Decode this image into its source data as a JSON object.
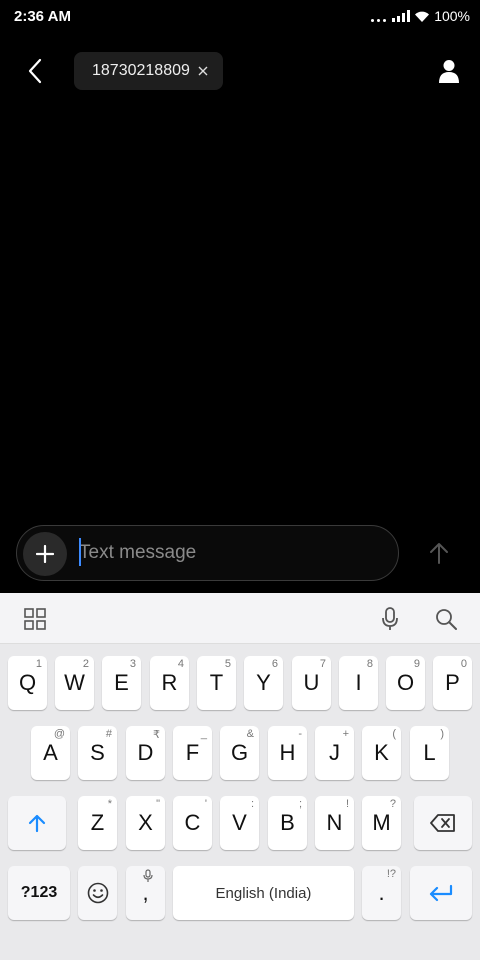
{
  "status": {
    "time": "2:36 AM",
    "battery": "100%"
  },
  "header": {
    "recipient": "18730218809"
  },
  "compose": {
    "placeholder": "Text message"
  },
  "keyboard": {
    "row1": [
      {
        "k": "Q",
        "h": "1"
      },
      {
        "k": "W",
        "h": "2"
      },
      {
        "k": "E",
        "h": "3"
      },
      {
        "k": "R",
        "h": "4"
      },
      {
        "k": "T",
        "h": "5"
      },
      {
        "k": "Y",
        "h": "6"
      },
      {
        "k": "U",
        "h": "7"
      },
      {
        "k": "I",
        "h": "8"
      },
      {
        "k": "O",
        "h": "9"
      },
      {
        "k": "P",
        "h": "0"
      }
    ],
    "row2": [
      {
        "k": "A",
        "h": "@"
      },
      {
        "k": "S",
        "h": "#"
      },
      {
        "k": "D",
        "h": "₹"
      },
      {
        "k": "F",
        "h": "_"
      },
      {
        "k": "G",
        "h": "&"
      },
      {
        "k": "H",
        "h": "-"
      },
      {
        "k": "J",
        "h": "+"
      },
      {
        "k": "K",
        "h": "("
      },
      {
        "k": "L",
        "h": ")"
      }
    ],
    "row3": [
      {
        "k": "Z",
        "h": "*"
      },
      {
        "k": "X",
        "h": "\""
      },
      {
        "k": "C",
        "h": "'"
      },
      {
        "k": "V",
        "h": ":"
      },
      {
        "k": "B",
        "h": ";"
      },
      {
        "k": "N",
        "h": "!"
      },
      {
        "k": "M",
        "h": "?"
      }
    ],
    "symbols_label": "?123",
    "comma": ",",
    "space_label": "English (India)",
    "period": ".",
    "period_hint": "!?"
  },
  "colors": {
    "accent": "#1a8cff",
    "background": "#000000",
    "keyboard_bg": "#e9e9eb"
  }
}
